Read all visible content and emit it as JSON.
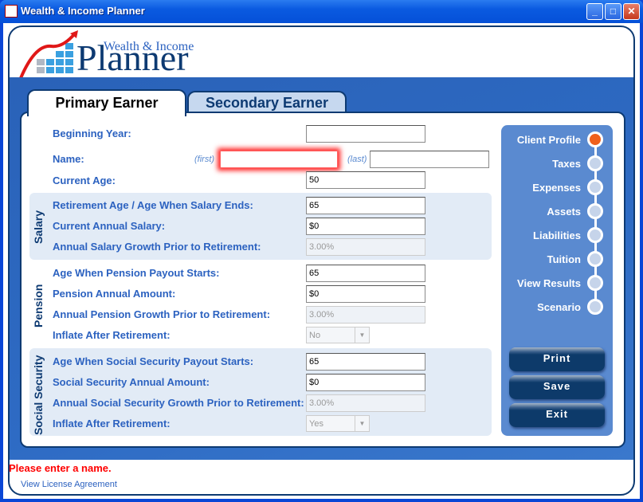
{
  "window": {
    "title": "Wealth & Income Planner",
    "minimize": "_",
    "maximize": "□",
    "close": "✕"
  },
  "logo": {
    "small": "Wealth & Income",
    "big": "Planner"
  },
  "tabs": [
    {
      "label": "Primary Earner",
      "active": true
    },
    {
      "label": "Secondary Earner",
      "active": false
    }
  ],
  "form": {
    "beginning_year": {
      "label": "Beginning Year:",
      "value": ""
    },
    "name": {
      "label": "Name:",
      "first_hint": "(first)",
      "last_hint": "(last)",
      "first": "",
      "last": ""
    },
    "current_age": {
      "label": "Current Age:",
      "value": "50"
    },
    "salary": {
      "group": "Salary",
      "retirement_age": {
        "label": "Retirement Age / Age When Salary Ends:",
        "value": "65"
      },
      "annual_salary": {
        "label": "Current Annual Salary:",
        "value": "$0"
      },
      "growth": {
        "label": "Annual Salary Growth Prior to Retirement:",
        "value": "3.00%"
      }
    },
    "pension": {
      "group": "Pension",
      "payout_age": {
        "label": "Age When Pension Payout Starts:",
        "value": "65"
      },
      "amount": {
        "label": "Pension Annual Amount:",
        "value": "$0"
      },
      "growth": {
        "label": "Annual Pension Growth Prior to Retirement:",
        "value": "3.00%"
      },
      "inflate": {
        "label": "Inflate After Retirement:",
        "value": "No"
      }
    },
    "social_security": {
      "group": "Social Security",
      "payout_age": {
        "label": "Age When Social Security Payout Starts:",
        "value": "65"
      },
      "amount": {
        "label": "Social Security Annual Amount:",
        "value": "$0"
      },
      "growth": {
        "label": "Annual Social Security Growth Prior to Retirement:",
        "value": "3.00%"
      },
      "inflate": {
        "label": "Inflate After Retirement:",
        "value": "Yes"
      }
    }
  },
  "nav": {
    "items": [
      "Client Profile",
      "Taxes",
      "Expenses",
      "Assets",
      "Liabilities",
      "Tuition",
      "View Results",
      "Scenario"
    ],
    "active_index": 0,
    "active_color": "#f0601c"
  },
  "actions": {
    "print": "Print",
    "save": "Save",
    "exit": "Exit"
  },
  "status": {
    "message": "Please enter a name.",
    "color": "#ff0000"
  },
  "footer": {
    "license_link": "View License Agreement"
  }
}
